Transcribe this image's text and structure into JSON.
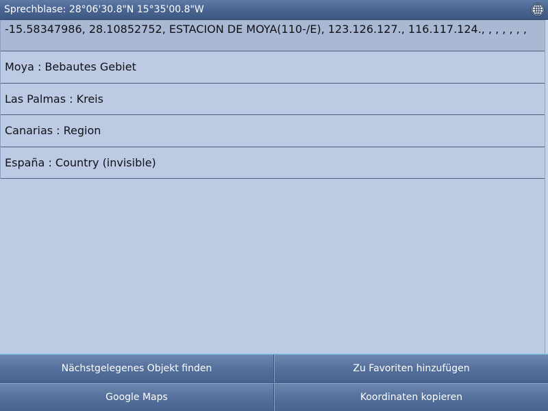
{
  "titlebar": {
    "title": "Sprechblase: 28°06'30.8\"N 15°35'00.8\"W",
    "icon": "globe-icon"
  },
  "info": {
    "coordinates_line": "-15.58347986, 28.10852752, ESTACION DE MOYA(110-/E), 123.126.127., 116.117.124., , , , , , ,",
    "rows": [
      "Moya : Bebautes Gebiet",
      "Las Palmas : Kreis",
      "Canarias : Region",
      "España : Country (invisible)"
    ]
  },
  "buttons": {
    "nearest_object": "Nächstgelegenes Objekt finden",
    "add_favorites": "Zu Favoriten hinzufügen",
    "google_maps": "Google Maps",
    "copy_coordinates": "Koordinaten kopieren"
  },
  "colors": {
    "titlebar": "#4a6591",
    "list_background": "#bccae3",
    "button_background": "#55709c"
  }
}
